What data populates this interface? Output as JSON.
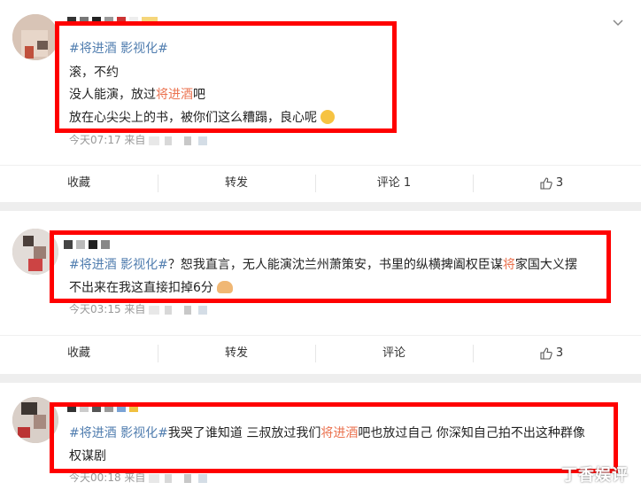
{
  "posts": [
    {
      "topic": "#将进酒 影视化#",
      "line1": "滚，不约",
      "line2_pre": "没人能演，放过",
      "line2_hl": "将进酒",
      "line2_post": "吧",
      "line3": "放在心尖尖上的书，被你们这么糟蹋，良心呢",
      "time": "今天07:17",
      "source_label": "来自",
      "actions": {
        "fav": "收藏",
        "repost": "转发",
        "comment": "评论 1",
        "like": "3"
      }
    },
    {
      "topic": "#将进酒 影视化#",
      "line1_rest": "？恕我直言，无人能演沈兰州萧策安，书里的纵横捭阖权臣谋",
      "line1_hl": "将",
      "line1_tail": "家国大义摆",
      "line2": "不出来在我这直接扣掉6分",
      "time": "今天03:15",
      "source_label": "来自",
      "actions": {
        "fav": "收藏",
        "repost": "转发",
        "comment": "评论",
        "like": "3"
      }
    },
    {
      "topic": "#将进酒 影视化#",
      "line1_a": "我哭了谁知道 三叔放过我们",
      "line1_hl": "将进酒",
      "line1_b": "吧也放过自己 你深知自己拍不出这种群像",
      "line2": "权谋剧",
      "time": "今天00:18",
      "source_label": "来自"
    }
  ],
  "watermark": "丁香娱评",
  "colors": {
    "highlight": "#eb7350",
    "topic": "#507daf",
    "box": "#ff0000"
  }
}
